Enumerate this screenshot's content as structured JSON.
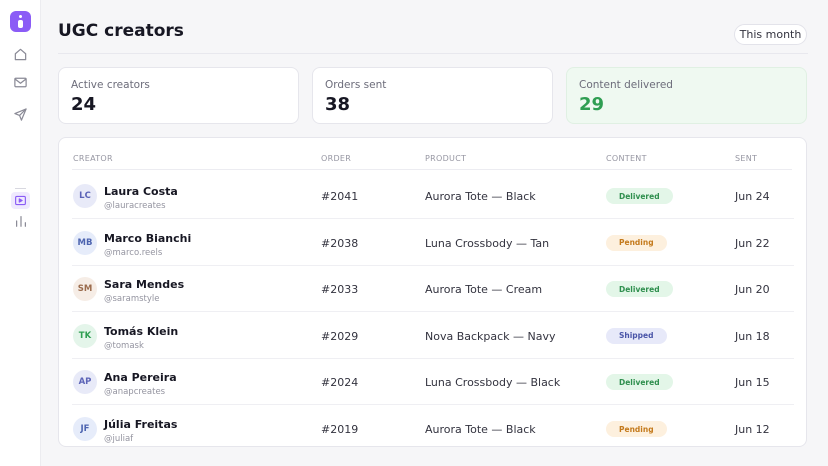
{
  "app": {
    "rail_icons": [
      "app-logo-icon",
      "home-icon",
      "mail-icon",
      "send-icon",
      "video-icon",
      "bar-chart-icon"
    ],
    "accent": "#8b5cf6"
  },
  "header": {
    "title": "UGC creators",
    "period_label": "This month"
  },
  "stats": [
    {
      "label": "Active creators",
      "value": "24"
    },
    {
      "label": "Orders sent",
      "value": "38"
    },
    {
      "label": "Content delivered",
      "value": "29",
      "highlight_color": "#2f9e52"
    }
  ],
  "table": {
    "columns": [
      "CREATOR",
      "ORDER",
      "PRODUCT",
      "CONTENT",
      "SENT"
    ],
    "rows": [
      {
        "initials": "LC",
        "name": "Laura Costa",
        "handle": "@lauracreates",
        "order": "#2041",
        "product": "Aurora Tote — Black",
        "status": "Delivered",
        "sent": "Jun 24",
        "avatar_bg": "#e8eaf8",
        "avatar_fg": "#5b63b7"
      },
      {
        "initials": "MB",
        "name": "Marco Bianchi",
        "handle": "@marco.reels",
        "order": "#2038",
        "product": "Luna Crossbody — Tan",
        "status": "Pending",
        "sent": "Jun 22",
        "avatar_bg": "#e6ecfa",
        "avatar_fg": "#4d64b0"
      },
      {
        "initials": "SM",
        "name": "Sara Mendes",
        "handle": "@saramstyle",
        "order": "#2033",
        "product": "Aurora Tote — Cream",
        "status": "Delivered",
        "sent": "Jun 20",
        "avatar_bg": "#f6ede6",
        "avatar_fg": "#9a6b4c"
      },
      {
        "initials": "TK",
        "name": "Tomás Klein",
        "handle": "@tomask",
        "order": "#2029",
        "product": "Nova Backpack — Navy",
        "status": "Shipped",
        "sent": "Jun 18",
        "avatar_bg": "#e4f5ea",
        "avatar_fg": "#2f9e52"
      },
      {
        "initials": "AP",
        "name": "Ana Pereira",
        "handle": "@anapcreates",
        "order": "#2024",
        "product": "Luna Crossbody — Black",
        "status": "Delivered",
        "sent": "Jun 15",
        "avatar_bg": "#e8eaf8",
        "avatar_fg": "#5b63b7"
      },
      {
        "initials": "JF",
        "name": "Júlia Freitas",
        "handle": "@juliaf",
        "order": "#2019",
        "product": "Aurora Tote — Black",
        "status": "Pending",
        "sent": "Jun 12",
        "avatar_bg": "#e6ecfa",
        "avatar_fg": "#4d64b0"
      }
    ]
  },
  "status_colors": {
    "Delivered": {
      "bg": "#e3f6e8",
      "fg": "#2f8f4e"
    },
    "Pending": {
      "bg": "#fdf0de",
      "fg": "#c47a1c"
    },
    "Shipped": {
      "bg": "#e7e9f9",
      "fg": "#4a55a8"
    }
  }
}
